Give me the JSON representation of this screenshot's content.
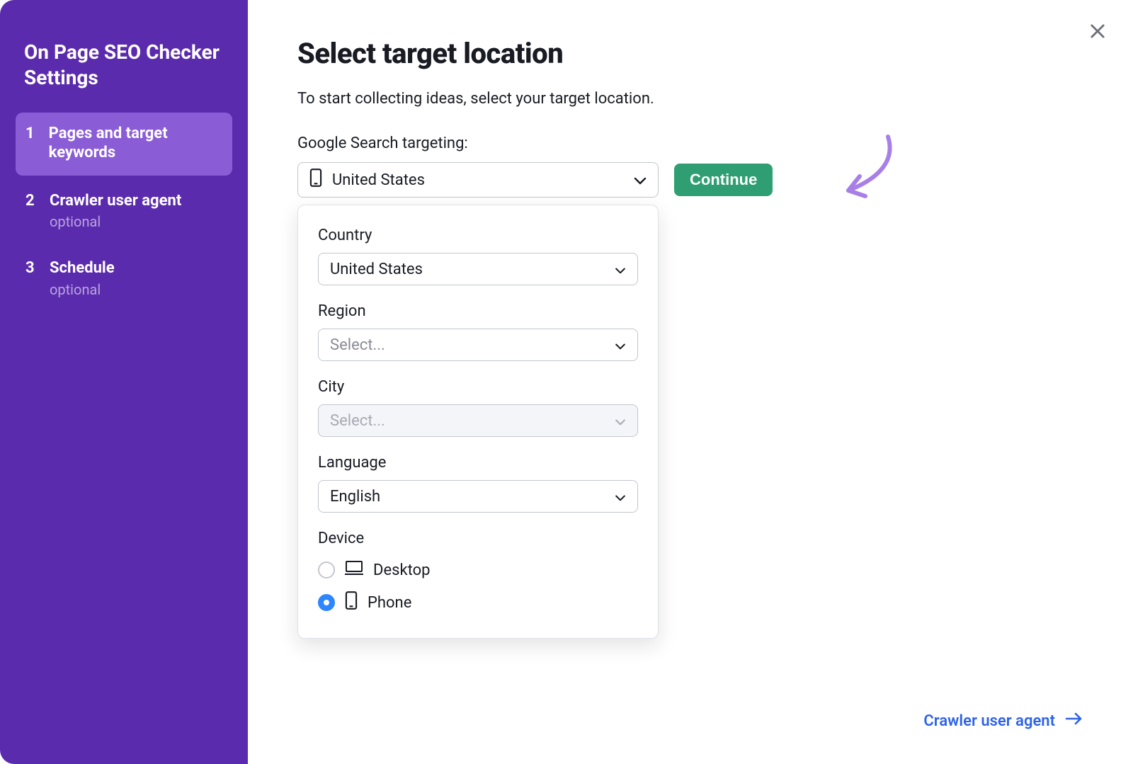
{
  "sidebar": {
    "title": "On Page SEO Checker Settings",
    "steps": [
      {
        "num": "1",
        "label": "Pages and target keywords",
        "hint": "",
        "active": true
      },
      {
        "num": "2",
        "label": "Crawler user agent",
        "hint": "optional",
        "active": false
      },
      {
        "num": "3",
        "label": "Schedule",
        "hint": "optional",
        "active": false
      }
    ]
  },
  "main": {
    "title": "Select target location",
    "intro": "To start collecting ideas, select your target location.",
    "targeting_label": "Google Search targeting:",
    "targeting_value": "United States",
    "continue_label": "Continue"
  },
  "popover": {
    "country_label": "Country",
    "country_value": "United States",
    "region_label": "Region",
    "region_placeholder": "Select...",
    "city_label": "City",
    "city_placeholder": "Select...",
    "language_label": "Language",
    "language_value": "English",
    "device_label": "Device",
    "device_desktop": "Desktop",
    "device_phone": "Phone"
  },
  "footer": {
    "next_label": "Crawler user agent"
  }
}
